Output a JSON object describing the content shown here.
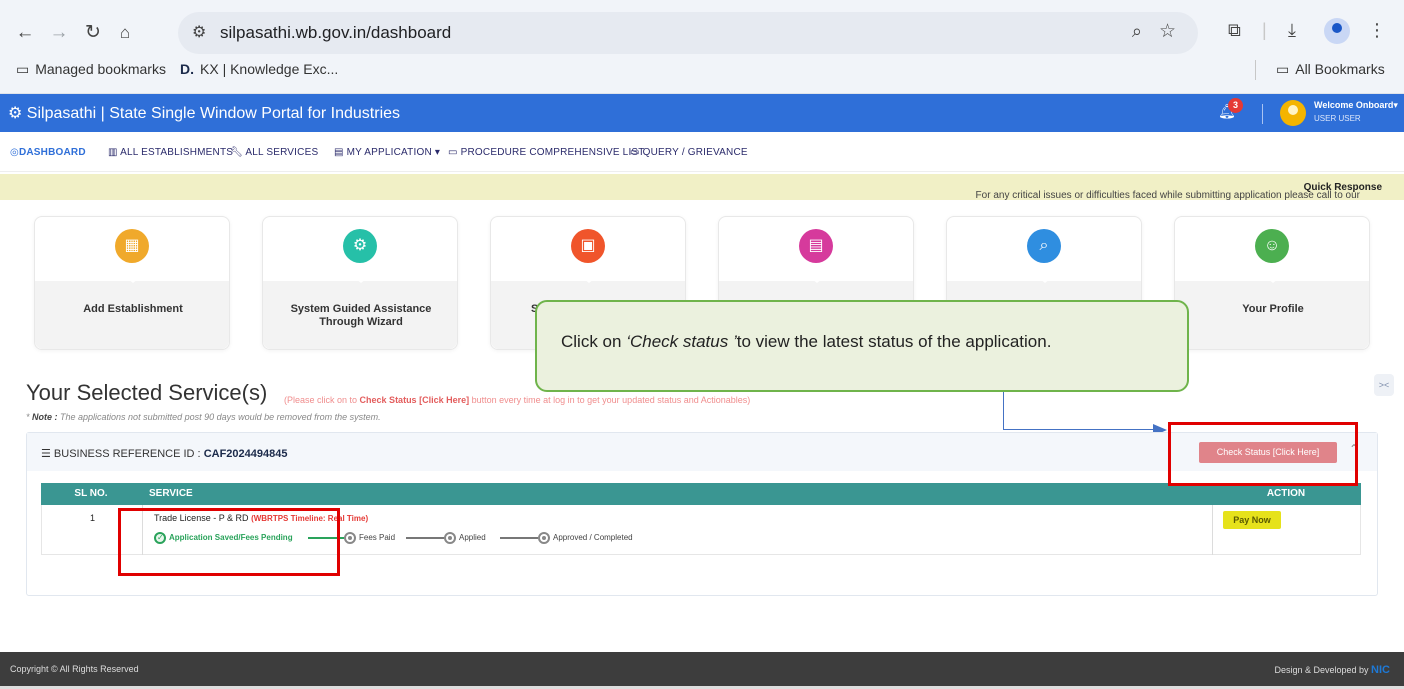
{
  "browser": {
    "url": "silpasathi.wb.gov.in/dashboard",
    "bookmarks": [
      {
        "label": "Managed bookmarks"
      },
      {
        "label": "KX | Knowledge Exc..."
      }
    ],
    "all_bookmarks": "All Bookmarks"
  },
  "header": {
    "title": "Silpasathi | State Single Window Portal for Industries",
    "notification_count": "3",
    "welcome": "Welcome Onboard",
    "user": "USER USER",
    "color": "#2f6fd8"
  },
  "menu": [
    {
      "label": "DASHBOARD",
      "icon": "dashboard-icon"
    },
    {
      "label": "ALL ESTABLISHMENTS",
      "icon": "building-icon"
    },
    {
      "label": "ALL SERVICES",
      "icon": "wrench-icon"
    },
    {
      "label": "MY APPLICATION",
      "icon": "document-icon"
    },
    {
      "label": "PROCEDURE COMPREHENSIVE LIST",
      "icon": "list-icon"
    },
    {
      "label": "QUERY / GRIEVANCE",
      "icon": "chat-icon"
    }
  ],
  "notice": {
    "text": "For any critical issues or difficulties faced while submitting application please call to our ",
    "bold": "Quick Response"
  },
  "tiles": [
    {
      "label": "Add Establishment",
      "icon": "building-icon",
      "color": "#f0a92b"
    },
    {
      "label": "System Guided Assistance Through Wizard",
      "icon": "gear-icon",
      "color": "#26c0a8"
    },
    {
      "label": "S",
      "icon": "apps-icon",
      "color": "#f0552b"
    },
    {
      "label": "",
      "icon": "id-card-icon",
      "color": "#d63a9c"
    },
    {
      "label": "",
      "icon": "search-icon",
      "color": "#2f8ee0"
    },
    {
      "label": "Your Profile",
      "icon": "profile-icon",
      "color": "#4caf50"
    }
  ],
  "callout": {
    "prefix": "Click on ",
    "emph": "‘Check status ’",
    "suffix": "to view the latest status of the application."
  },
  "selected": {
    "title": "Your Selected Service(s)",
    "sub_pre": "(Please click on to ",
    "sub_bold": "Check Status [Click Here]",
    "sub_post": " button every time at log in to get your updated status and Actionables)",
    "note_label": "Note :",
    "note": " The applications not submitted post 90 days would be removed from the system."
  },
  "card": {
    "ref_label": "BUSINESS REFERENCE ID :",
    "ref_id": "CAF2024494845",
    "check_status": "Check Status [Click Here]",
    "columns": [
      "SL NO.",
      "SERVICE",
      "ACTION"
    ],
    "rows": [
      {
        "sl": "1",
        "service": "Trade License - P & RD",
        "timeline": "(WBRTPS Timeline: Real Time)",
        "steps": [
          "Application Saved/Fees Pending",
          "Fees Paid",
          "Applied",
          "Approved / Completed"
        ],
        "action": "Pay Now"
      }
    ]
  },
  "footer": {
    "copyright": "Copyright © All Rights Reserved",
    "designed": "Design & Developed by",
    "nic": "NIC"
  }
}
